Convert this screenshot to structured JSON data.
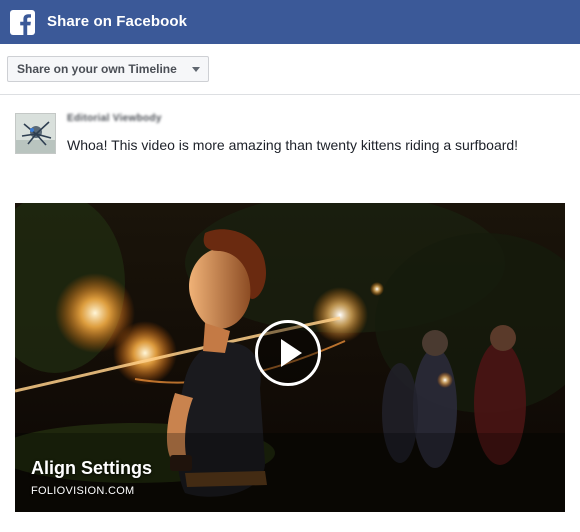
{
  "dialog": {
    "title": "Share on Facebook",
    "logo_icon": "facebook-f-icon",
    "brand_color": "#3b5998"
  },
  "destination": {
    "selected": "Share on your own Timeline",
    "caret_icon": "caret-down-icon"
  },
  "post": {
    "author_name": "Editorial Viewbody",
    "message": "Whoa! This video is more amazing than twenty kittens riding a surfboard!"
  },
  "attachment": {
    "title": "Align Settings",
    "domain": "FOLIOVISION.COM",
    "play_icon": "play-icon"
  }
}
